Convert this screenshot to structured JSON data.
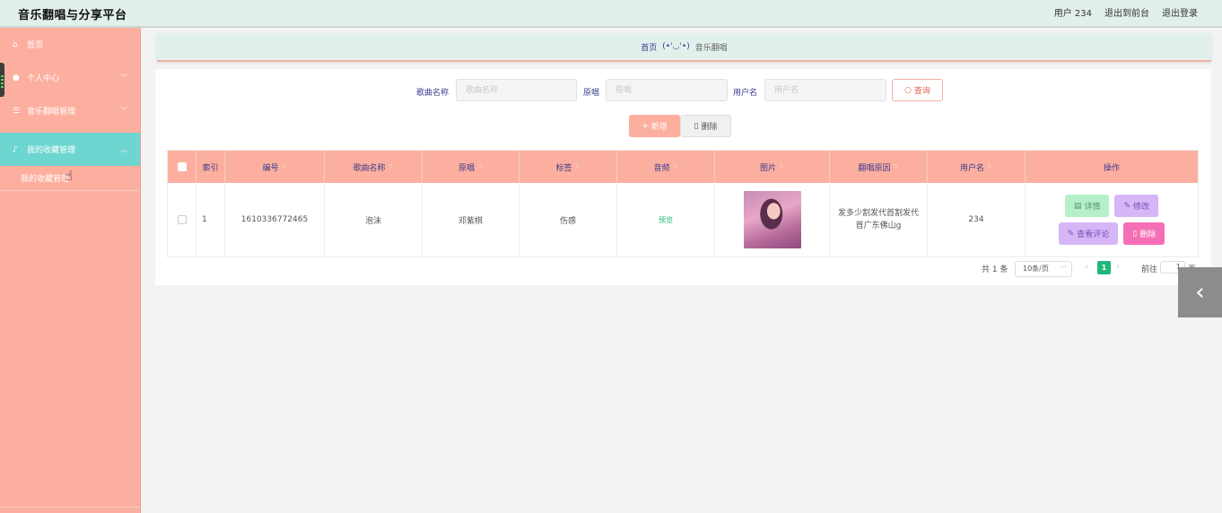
{
  "header": {
    "title": "音乐翻唱与分享平台",
    "user": "用户 234",
    "to_front": "退出到前台",
    "logout": "退出登录"
  },
  "sidebar": {
    "items": [
      {
        "icon": "home-icon",
        "label": "首页"
      },
      {
        "icon": "user-icon",
        "label": "个人中心"
      },
      {
        "icon": "list-icon",
        "label": "音乐翻唱管理"
      },
      {
        "icon": "mic-icon",
        "label": "我的收藏管理"
      }
    ],
    "sub_items": [
      {
        "label": "我的收藏管理"
      }
    ]
  },
  "breadcrumb": {
    "home": "首页",
    "face": "(•'◡'•)",
    "current": "音乐翻唱"
  },
  "search": {
    "song_label": "歌曲名称",
    "song_placeholder": "歌曲名称",
    "original_label": "原唱",
    "original_placeholder": "原唱",
    "user_label": "用户名",
    "user_placeholder": "用户名",
    "query_button": "查询"
  },
  "actions": {
    "add": "新增",
    "delete": "删除"
  },
  "table": {
    "columns": [
      "索引",
      "编号",
      "歌曲名称",
      "原唱",
      "标签",
      "音频",
      "图片",
      "翻唱原因",
      "用户名",
      "操作"
    ],
    "rows": [
      {
        "index": "1",
        "id": "1610336772465",
        "song": "泡沫",
        "original": "邓紫棋",
        "tag": "伤感",
        "audio": "预览",
        "reason": "发多少割发代首割发代首广东佛山g",
        "username": "234",
        "ops": {
          "detail": "详情",
          "edit": "修改",
          "comment": "查看评论",
          "remove": "删除"
        }
      }
    ]
  },
  "pagination": {
    "total": "共 1 条",
    "page_size": "10条/页",
    "current_page": "1",
    "goto_label": "前往",
    "goto_value": "1",
    "page_unit": "页"
  },
  "colors": {
    "sidebar": "#fdaf9f",
    "active_menu": "#6ed6d0",
    "header": "#e2f0ec",
    "accent_green": "#1fb87a"
  }
}
